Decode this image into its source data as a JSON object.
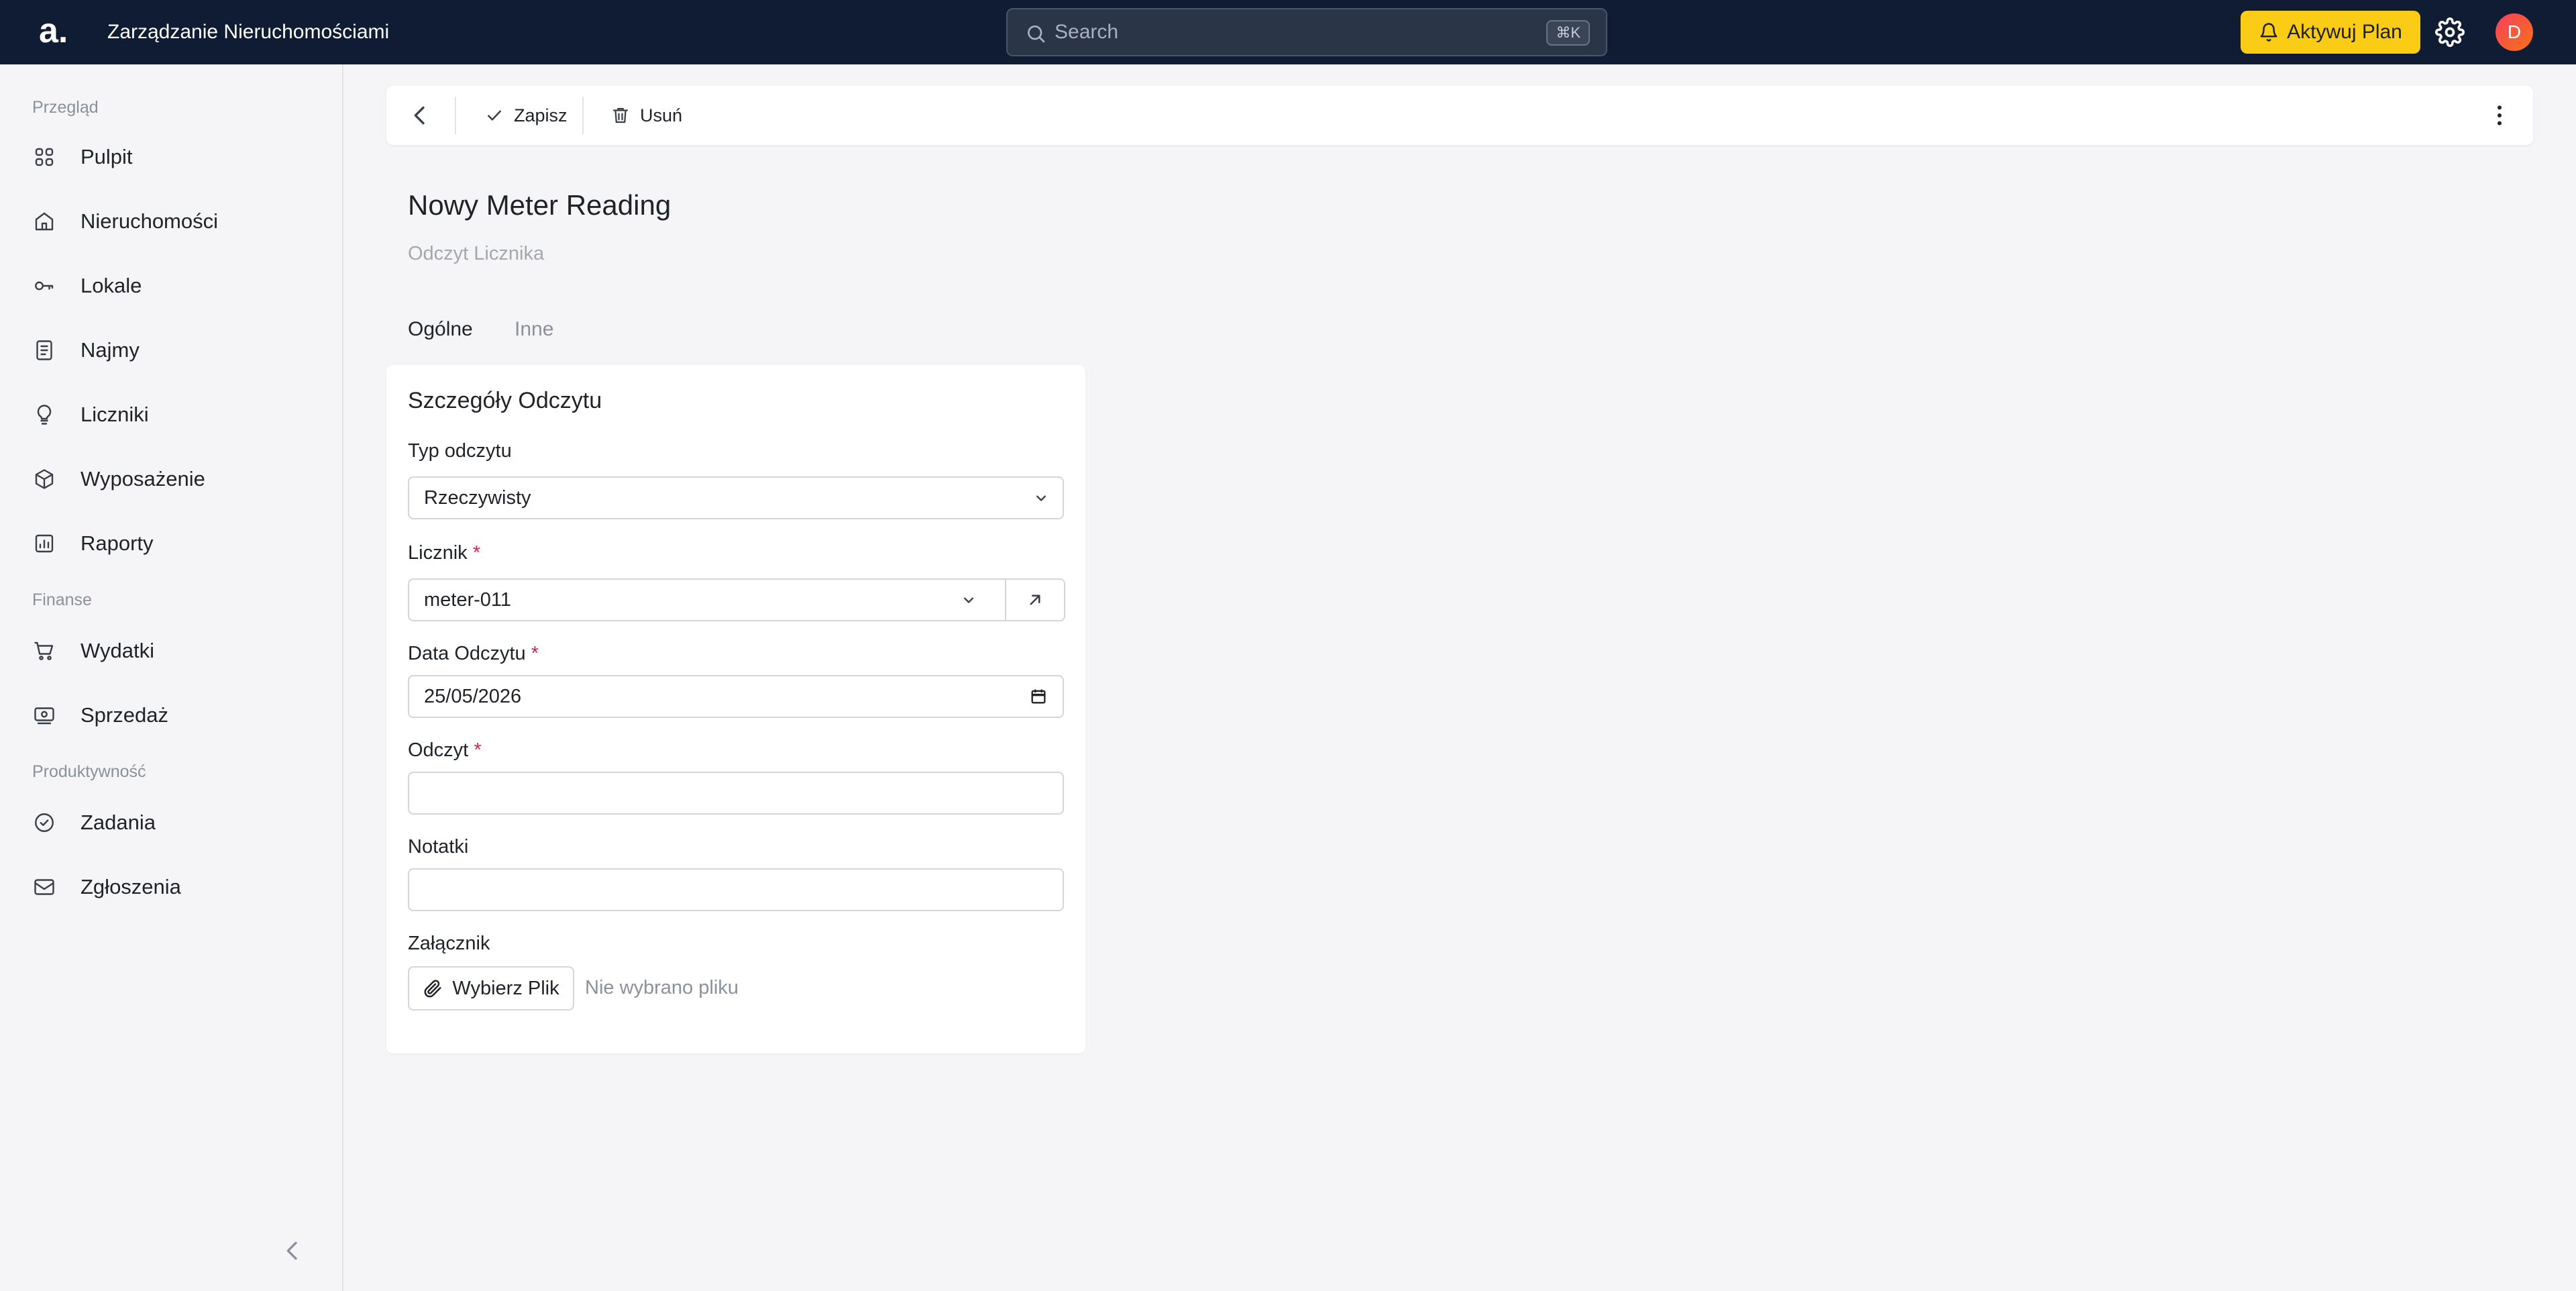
{
  "app": {
    "logo_text": "a.",
    "title": "Zarządzanie Nieruchomościami"
  },
  "search": {
    "placeholder": "Search",
    "shortcut": "⌘K"
  },
  "header": {
    "upgrade_label": "Aktywuj Plan",
    "avatar_initial": "D",
    "upgrade_color": "#facc15",
    "topbar_color": "#0f1c33"
  },
  "sidebar": {
    "sections": [
      {
        "title": "Przegląd",
        "items": [
          {
            "label": "Pulpit",
            "icon": "grid-icon"
          },
          {
            "label": "Nieruchomości",
            "icon": "house-icon"
          },
          {
            "label": "Lokale",
            "icon": "key-icon"
          },
          {
            "label": "Najmy",
            "icon": "document-icon"
          },
          {
            "label": "Liczniki",
            "icon": "lightbulb-icon"
          },
          {
            "label": "Wyposażenie",
            "icon": "cube-icon"
          },
          {
            "label": "Raporty",
            "icon": "chart-icon"
          }
        ]
      },
      {
        "title": "Finanse",
        "items": [
          {
            "label": "Wydatki",
            "icon": "cart-icon"
          },
          {
            "label": "Sprzedaż",
            "icon": "cash-icon"
          }
        ]
      },
      {
        "title": "Produktywność",
        "items": [
          {
            "label": "Zadania",
            "icon": "check-circle-icon"
          },
          {
            "label": "Zgłoszenia",
            "icon": "mail-icon"
          }
        ]
      }
    ]
  },
  "toolbar": {
    "save_label": "Zapisz",
    "delete_label": "Usuń"
  },
  "page": {
    "title": "Nowy Meter Reading",
    "subtitle": "Odczyt Licznika",
    "tabs": [
      {
        "label": "Ogólne",
        "active": true
      },
      {
        "label": "Inne",
        "active": false
      }
    ]
  },
  "form": {
    "card_title": "Szczegóły Odczytu",
    "reading_type": {
      "label": "Typ odczytu",
      "value": "Rzeczywisty"
    },
    "meter": {
      "label": "Licznik",
      "required_mark": "*",
      "value": "meter-011"
    },
    "reading_date": {
      "label": "Data Odczytu",
      "required_mark": "*",
      "value": "25/05/2026"
    },
    "reading": {
      "label": "Odczyt",
      "required_mark": "*",
      "value": ""
    },
    "notes": {
      "label": "Notatki",
      "value": ""
    },
    "attachment": {
      "label": "Załącznik",
      "button_label": "Wybierz Plik",
      "status": "Nie wybrano pliku"
    }
  }
}
